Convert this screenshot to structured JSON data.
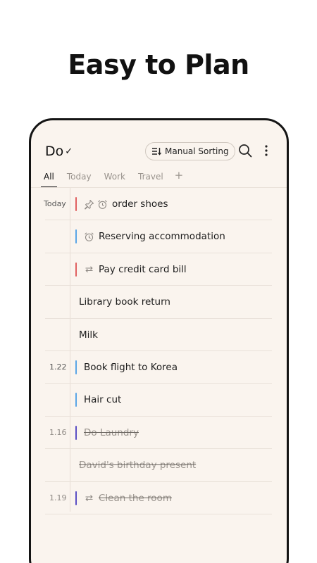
{
  "headline": "Easy to Plan",
  "app": {
    "logo_text": "Do",
    "logo_mark": "✓",
    "sort_label": "Manual Sorting"
  },
  "tabs": [
    {
      "label": "All",
      "active": true
    },
    {
      "label": "Today",
      "active": false
    },
    {
      "label": "Work",
      "active": false
    },
    {
      "label": "Travel",
      "active": false
    }
  ],
  "tab_add_label": "+",
  "colors": {
    "red": "#e06060",
    "blue": "#5aa5e6",
    "purple": "#5b4fc4",
    "background": "#faf4ee"
  },
  "tasks": [
    {
      "date": "Today",
      "title": "order shoes",
      "bar": "red",
      "icons": [
        "pin-icon",
        "alarm-icon"
      ],
      "done": false
    },
    {
      "date": "",
      "title": "Reserving accommodation",
      "bar": "blue",
      "icons": [
        "alarm-icon"
      ],
      "done": false
    },
    {
      "date": "",
      "title": "Pay credit card bill",
      "bar": "red",
      "icons": [
        "repeat-icon"
      ],
      "done": false
    },
    {
      "date": "",
      "title": "Library book return",
      "bar": "",
      "icons": [],
      "done": false
    },
    {
      "date": "",
      "title": "Milk",
      "bar": "",
      "icons": [],
      "done": false
    },
    {
      "date": "1.22",
      "title": "Book flight to Korea",
      "bar": "blue",
      "icons": [],
      "done": false
    },
    {
      "date": "",
      "title": "Hair cut",
      "bar": "blue",
      "icons": [],
      "done": false
    },
    {
      "date": "1.16",
      "title": "Do Laundry",
      "bar": "purple",
      "icons": [],
      "done": true
    },
    {
      "date": "",
      "title": "David's birthday present",
      "bar": "",
      "icons": [],
      "done": true
    },
    {
      "date": "1.19",
      "title": "Clean the room",
      "bar": "purple",
      "icons": [
        "repeat-icon"
      ],
      "done": true
    }
  ]
}
